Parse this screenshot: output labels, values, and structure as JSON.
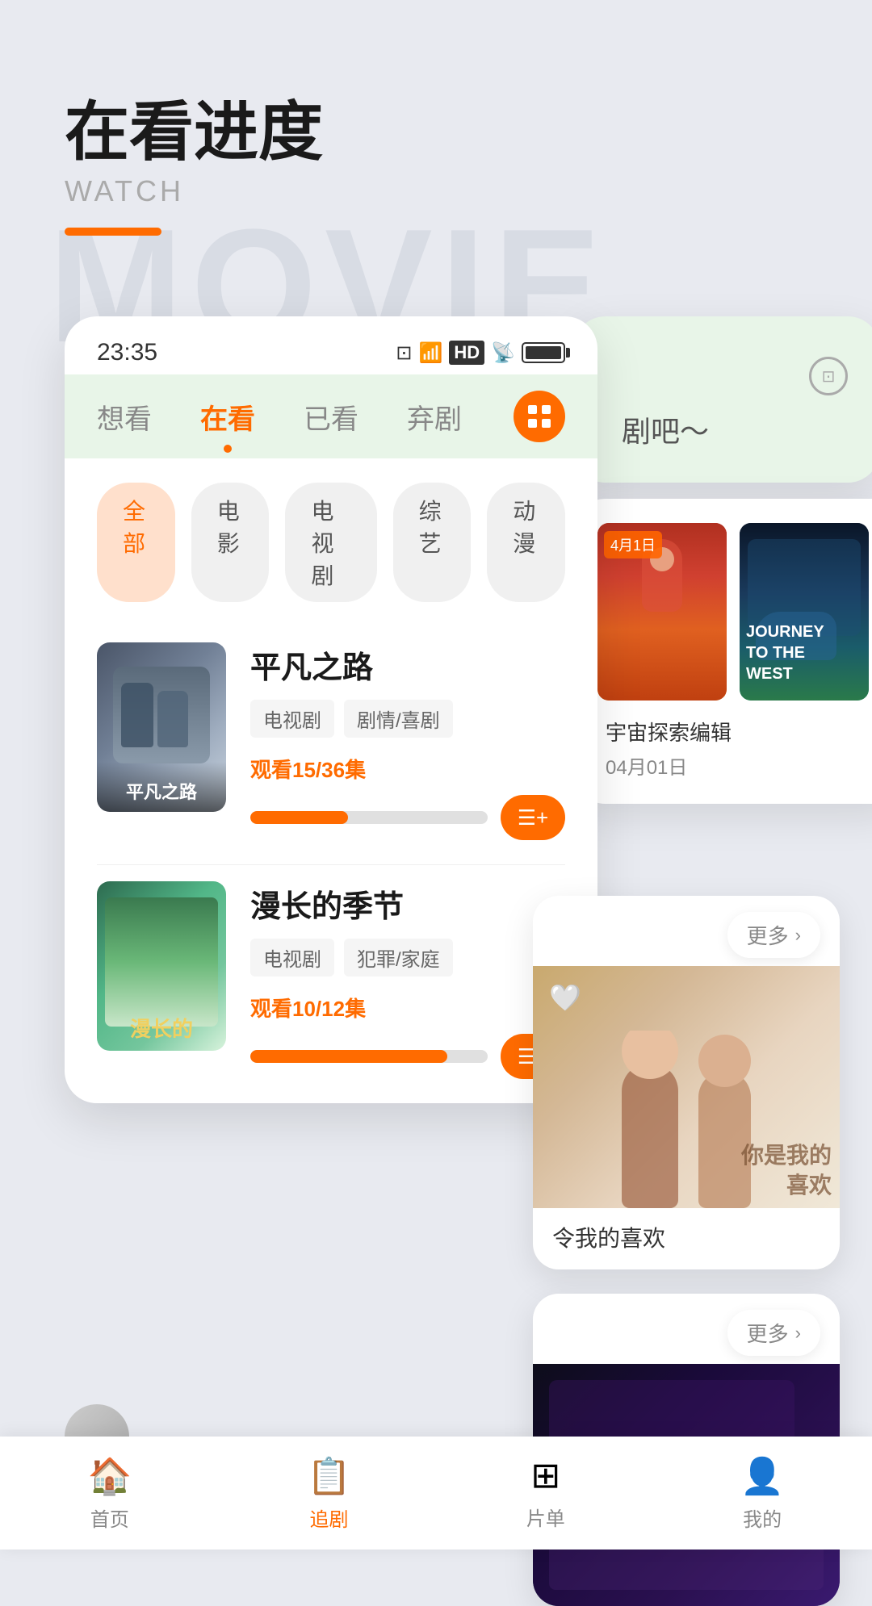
{
  "header": {
    "title_zh": "在看进度",
    "title_en": "WATCH"
  },
  "status_bar": {
    "time": "23:35",
    "icons": [
      "nfc",
      "wifi",
      "hd",
      "signal",
      "battery"
    ]
  },
  "tabs": [
    {
      "label": "想看",
      "active": false
    },
    {
      "label": "在看",
      "active": true
    },
    {
      "label": "已看",
      "active": false
    },
    {
      "label": "弃剧",
      "active": false
    }
  ],
  "filters": [
    {
      "label": "全部",
      "active": true
    },
    {
      "label": "电影",
      "active": false
    },
    {
      "label": "电视剧",
      "active": false
    },
    {
      "label": "综艺",
      "active": false
    },
    {
      "label": "动漫",
      "active": false
    }
  ],
  "movies": [
    {
      "title": "平凡之路",
      "tags": [
        "电视剧",
        "剧情/喜剧"
      ],
      "progress_text": "观看15/36集",
      "progress_pct": 41
    },
    {
      "title": "漫长的季节",
      "tags": [
        "电视剧",
        "犯罪/家庭"
      ],
      "progress_text": "观看10/12集",
      "progress_pct": 83
    }
  ],
  "right_panel": {
    "green_card_text": "剧吧～",
    "poster_subtitle": "宇宙探索编辑",
    "poster_date": "04月01日",
    "sp_label": "4月1日"
  },
  "rec_cards": [
    {
      "more_label": "更多",
      "title": "令我的喜欢"
    },
    {
      "more_label": "更多",
      "title": ""
    }
  ],
  "bottom_nav": [
    {
      "label": "首页",
      "icon": "🏠",
      "active": false
    },
    {
      "label": "追剧",
      "icon": "📋",
      "active": true
    },
    {
      "label": "片单",
      "icon": "⊞",
      "active": false
    },
    {
      "label": "我的",
      "icon": "👤",
      "active": false
    }
  ],
  "bg_text": "MOVIE"
}
